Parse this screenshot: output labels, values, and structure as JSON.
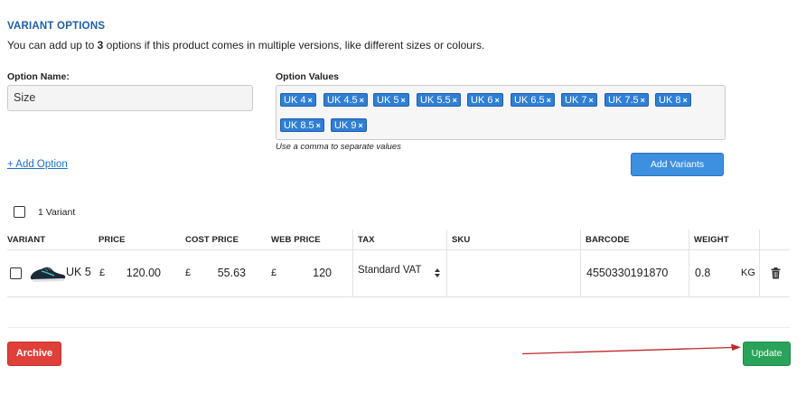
{
  "section": {
    "title": "VARIANT OPTIONS",
    "desc_pre": "You can add up to ",
    "desc_max": "3",
    "desc_post": " options if this product comes in multiple versions, like different sizes or colours."
  },
  "option_name": {
    "label": "Option Name:",
    "value": "Size"
  },
  "option_values": {
    "label": "Option Values",
    "tags": [
      "UK 4",
      "UK 4.5",
      "UK 5",
      "UK 5.5",
      "UK 6",
      "UK 6.5",
      "UK 7",
      "UK 7.5",
      "UK 8",
      "UK 8.5",
      "UK 9"
    ],
    "remove_glyph": "×",
    "hint": "Use a comma to separate values"
  },
  "add_option_link": "+ Add Option",
  "add_variants_button": "Add Variants",
  "variant_count_label": "1 Variant",
  "table": {
    "headers": {
      "variant": "VARIANT",
      "price": "PRICE",
      "cost_price": "COST PRICE",
      "web_price": "WEB PRICE",
      "tax": "TAX",
      "sku": "SKU",
      "barcode": "BARCODE",
      "weight": "WEIGHT"
    },
    "row": {
      "name": "UK 5",
      "currency": "£",
      "price": "120.00",
      "cost_price": "55.63",
      "web_price": "120",
      "tax": "Standard VAT",
      "sku": "",
      "barcode": "4550330191870",
      "weight": "0.8",
      "weight_unit": "KG"
    }
  },
  "archive_button": "Archive",
  "update_button": "Update",
  "colors": {
    "accent": "#1f5fa3",
    "tag_bg": "#2f7fd4",
    "archive": "#e0403a",
    "update": "#2aa35a",
    "annotation_arrow": "#c0262b"
  },
  "icons": {
    "product_thumbnail": "running-shoe-icon",
    "delete": "trash-icon",
    "tax_select": "select-arrows-icon"
  }
}
